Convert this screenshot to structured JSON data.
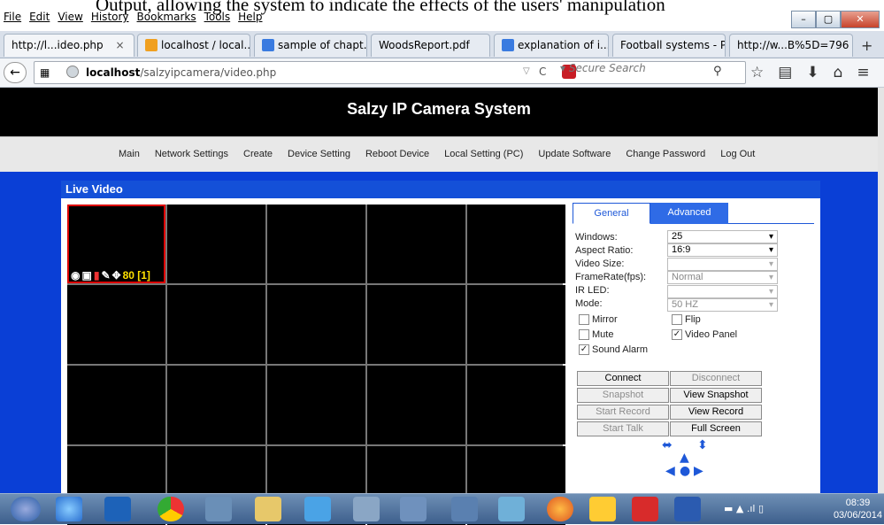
{
  "overlay": {
    "caption": "Output, allowing the system to indicate the effects of the users' manipulation"
  },
  "menubar": {
    "items": [
      "File",
      "Edit",
      "View",
      "History",
      "Bookmarks",
      "Tools",
      "Help"
    ]
  },
  "tabs": [
    {
      "label": "http://l...ideo.php"
    },
    {
      "label": "localhost / local..."
    },
    {
      "label": "sample of chapt..."
    },
    {
      "label": "WoodsReport.pdf"
    },
    {
      "label": "explanation of i..."
    },
    {
      "label": "Football systems - P..."
    },
    {
      "label": "http://w...B%5D=796"
    }
  ],
  "tab_close": "×",
  "tab_new": "+",
  "address": {
    "host": "localhost",
    "path": "/salzyipcamera/video.php"
  },
  "search": {
    "placeholder": "Secure Search"
  },
  "site": {
    "title": "Salzy IP Camera System",
    "menu": [
      "Main",
      "Network Settings",
      "Create",
      "Device Setting",
      "Reboot Device",
      "Local Setting (PC)",
      "Update Software",
      "Change Password",
      "Log Out"
    ],
    "panel_title": "Live Video",
    "cell_status": "80 [1]",
    "side_tabs": [
      "General",
      "Advanced"
    ],
    "fields": [
      {
        "label": "Windows:",
        "value": "25"
      },
      {
        "label": "Aspect Ratio:",
        "value": "16:9"
      },
      {
        "label": "Video Size:",
        "value": ""
      },
      {
        "label": "FrameRate(fps):",
        "value": "Normal"
      },
      {
        "label": "IR LED:",
        "value": ""
      },
      {
        "label": "Mode:",
        "value": "50 HZ"
      }
    ],
    "checkboxes": {
      "mirror": "Mirror",
      "flip": "Flip",
      "mute": "Mute",
      "video_panel": "Video Panel",
      "sound_alarm": "Sound Alarm"
    },
    "buttons": {
      "connect": "Connect",
      "disconnect": "Disconnect",
      "snapshot": "Snapshot",
      "view_snapshot": "View Snapshot",
      "start_record": "Start Record",
      "view_record": "View Record",
      "start_talk": "Start Talk",
      "full_screen": "Full Screen"
    }
  },
  "taskbar": {
    "time": "08:39",
    "date": "03/06/2014"
  }
}
